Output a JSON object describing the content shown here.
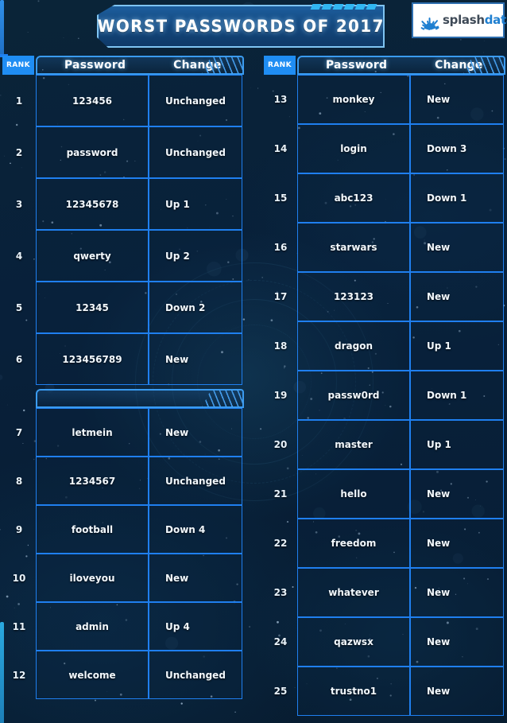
{
  "header": {
    "title": "WORST PASSWORDS OF 2017",
    "logo": {
      "icon": "splash-burst-icon",
      "word_primary": "splash",
      "word_accent": "data"
    }
  },
  "colors": {
    "background": "#0a2033",
    "border_blue": "#1f7fef",
    "accent_cyan": "#31b7f2",
    "badge_blue": "#1f8df3",
    "title_panel": "#14477d",
    "logo_accent": "#1f7fd0"
  },
  "columns": {
    "rank": "RANK",
    "password": "Password",
    "change": "Change"
  },
  "blocks": [
    {
      "id": "left-top",
      "show_header_labels": true,
      "rows": [
        {
          "rank": "1",
          "password": "123456",
          "change": "Unchanged"
        },
        {
          "rank": "2",
          "password": "password",
          "change": "Unchanged"
        },
        {
          "rank": "3",
          "password": "12345678",
          "change": "Up 1"
        },
        {
          "rank": "4",
          "password": "qwerty",
          "change": "Up 2"
        },
        {
          "rank": "5",
          "password": "12345",
          "change": "Down 2"
        },
        {
          "rank": "6",
          "password": "123456789",
          "change": "New"
        }
      ]
    },
    {
      "id": "left-bottom",
      "show_header_labels": false,
      "rows": [
        {
          "rank": "7",
          "password": "letmein",
          "change": "New"
        },
        {
          "rank": "8",
          "password": "1234567",
          "change": "Unchanged"
        },
        {
          "rank": "9",
          "password": "football",
          "change": "Down 4"
        },
        {
          "rank": "10",
          "password": "iloveyou",
          "change": "New"
        },
        {
          "rank": "11",
          "password": "admin",
          "change": "Up 4"
        },
        {
          "rank": "12",
          "password": "welcome",
          "change": "Unchanged"
        }
      ]
    },
    {
      "id": "right",
      "show_header_labels": true,
      "rows": [
        {
          "rank": "13",
          "password": "monkey",
          "change": "New"
        },
        {
          "rank": "14",
          "password": "login",
          "change": "Down 3"
        },
        {
          "rank": "15",
          "password": "abc123",
          "change": "Down 1"
        },
        {
          "rank": "16",
          "password": "starwars",
          "change": "New"
        },
        {
          "rank": "17",
          "password": "123123",
          "change": "New"
        },
        {
          "rank": "18",
          "password": "dragon",
          "change": "Up 1"
        },
        {
          "rank": "19",
          "password": "passw0rd",
          "change": "Down 1"
        },
        {
          "rank": "20",
          "password": "master",
          "change": "Up 1"
        },
        {
          "rank": "21",
          "password": "hello",
          "change": "New"
        },
        {
          "rank": "22",
          "password": "freedom",
          "change": "New"
        },
        {
          "rank": "23",
          "password": "whatever",
          "change": "New"
        },
        {
          "rank": "24",
          "password": "qazwsx",
          "change": "New"
        },
        {
          "rank": "25",
          "password": "trustno1",
          "change": "New"
        }
      ]
    }
  ]
}
